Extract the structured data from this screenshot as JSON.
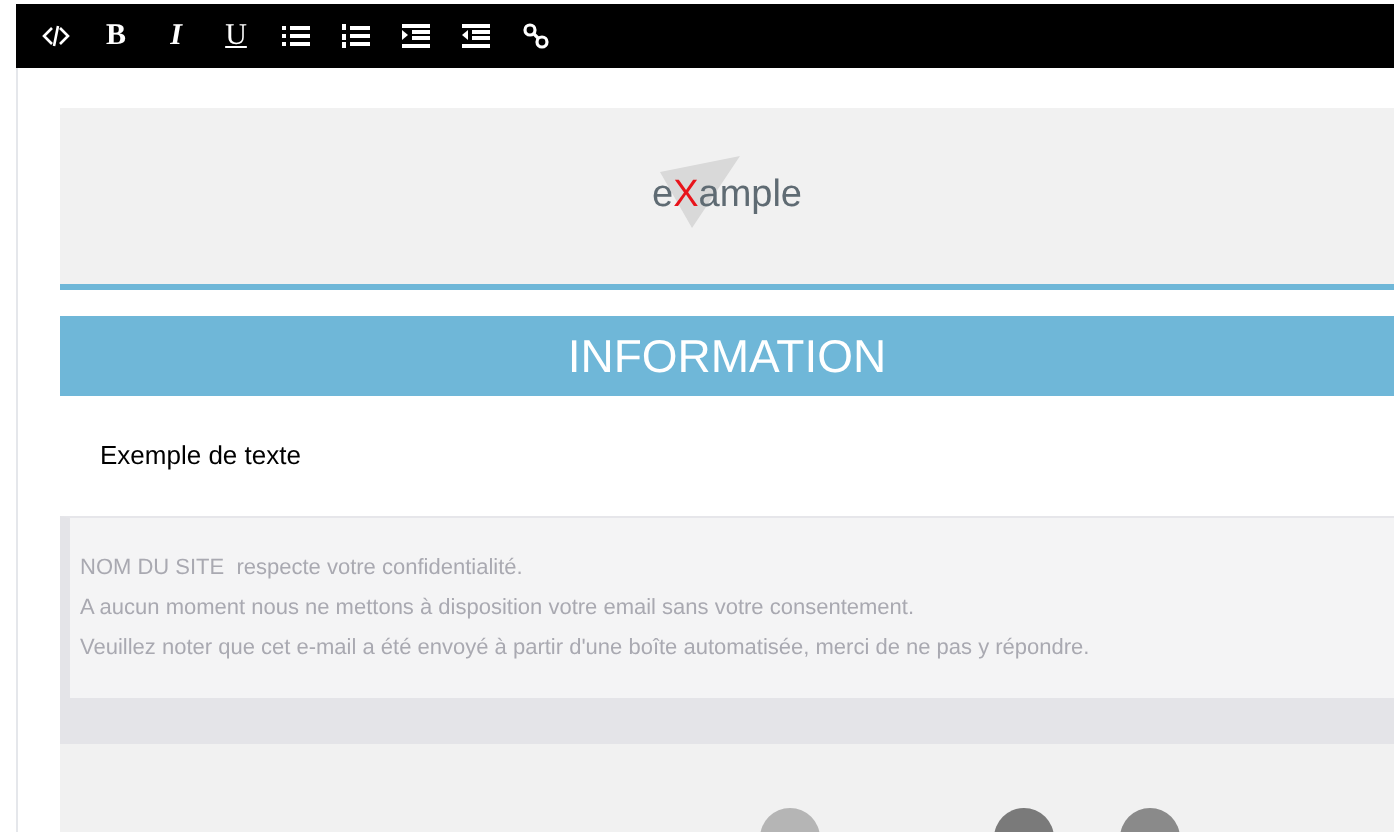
{
  "toolbar": [
    {
      "kind": "code"
    },
    {
      "kind": "bold",
      "label": "B"
    },
    {
      "kind": "italic",
      "label": "I"
    },
    {
      "kind": "underline",
      "label": "U"
    },
    {
      "kind": "bullets"
    },
    {
      "kind": "numbers"
    },
    {
      "kind": "indent"
    },
    {
      "kind": "outdent"
    },
    {
      "kind": "link"
    }
  ],
  "logo": {
    "parts": [
      {
        "text": "e",
        "color": "#5f6b73"
      },
      {
        "text": "X",
        "color": "#e8141b"
      },
      {
        "text": "ample",
        "color": "#5f6b73"
      }
    ]
  },
  "banner": {
    "title": "INFORMATION"
  },
  "body_text": "Exemple de texte",
  "notice": [
    "NOM DU SITE  respecte votre confidentialité.",
    "A aucun moment nous ne mettons à disposition votre email sans votre consentement.",
    "Veuillez noter que cet e-mail a été envoyé à partir d'une boîte automatisée, merci de ne pas y répondre."
  ]
}
